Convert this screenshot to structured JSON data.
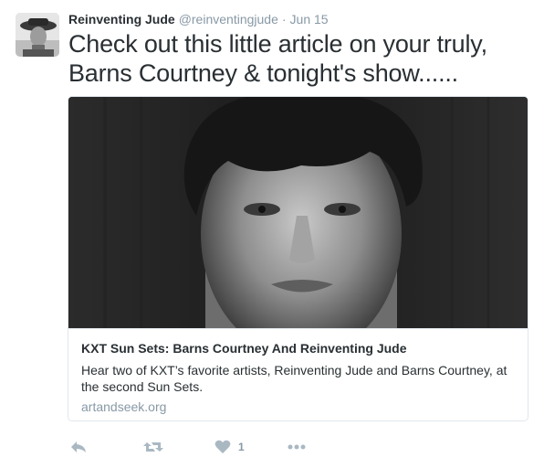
{
  "tweet": {
    "fullname": "Reinventing Jude",
    "username": "@reinventingjude",
    "separator": "·",
    "time": "Jun 15",
    "text": "Check out this little article on your truly, Barns Courtney & tonight's show......",
    "avatar_icon": "profile-photo",
    "card": {
      "title": "KXT Sun Sets: Barns Courtney And Reinventing Jude",
      "description": "Hear two of KXT’s favorite artists, Reinventing Jude and Barns Courtney, at the second Sun Sets.",
      "domain": "artandseek.org",
      "image_icon": "portrait-photo"
    },
    "actions": {
      "reply_icon": "reply-icon",
      "retweet_icon": "retweet-icon",
      "like_icon": "heart-icon",
      "like_count": "1",
      "more_icon": "more-icon"
    }
  },
  "colors": {
    "text": "#292f33",
    "muted": "#8899a6",
    "icon": "#aab8c2",
    "border": "#e1e8ed"
  }
}
